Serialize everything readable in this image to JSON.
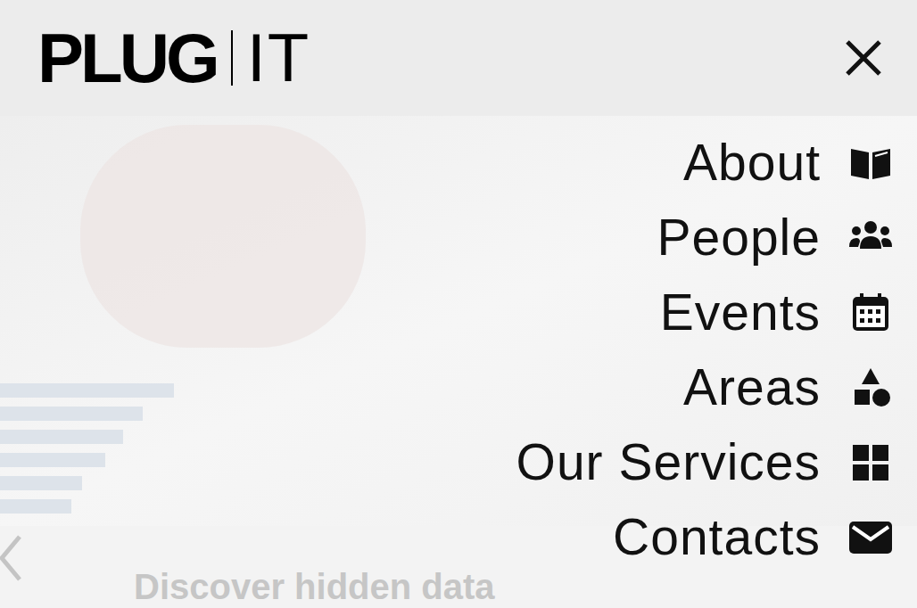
{
  "logo": {
    "brand": "PLUG",
    "suffix": "IT"
  },
  "menu": [
    {
      "label": "About"
    },
    {
      "label": "People"
    },
    {
      "label": "Events"
    },
    {
      "label": "Areas"
    },
    {
      "label": "Our Services"
    },
    {
      "label": "Contacts"
    }
  ],
  "hero": {
    "heading": "Discover hidden data"
  }
}
